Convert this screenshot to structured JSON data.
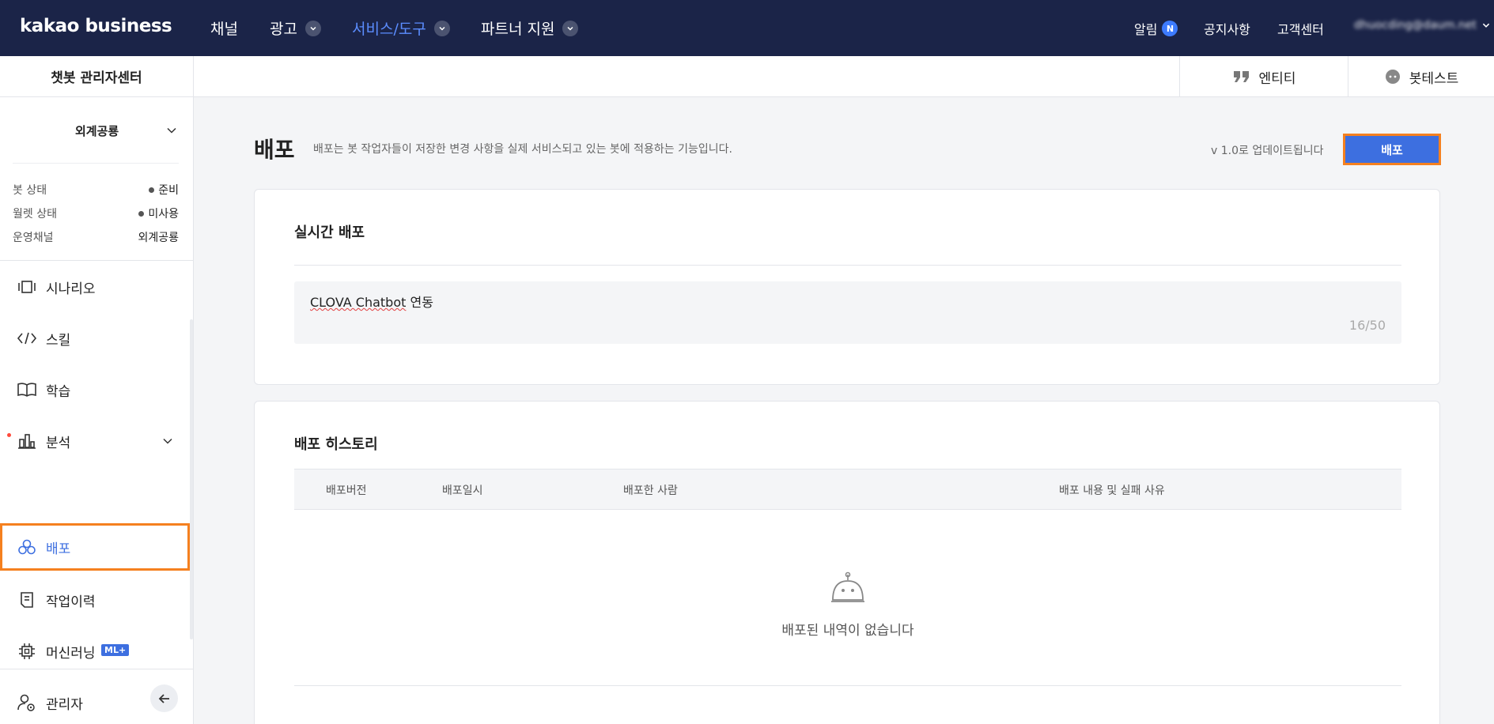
{
  "topbar": {
    "logo": "kakao business",
    "nav": [
      {
        "label": "채널"
      },
      {
        "label": "광고"
      },
      {
        "label": "서비스/도구"
      },
      {
        "label": "파트너 지원"
      }
    ],
    "notifications_label": "알림",
    "notifications_badge": "N",
    "notice_label": "공지사항",
    "support_label": "고객센터",
    "account_label": "dhuocding@daum.net"
  },
  "sidebar": {
    "title": "챗봇 관리자센터",
    "channel_select": "외계공룡",
    "status": [
      {
        "label": "봇 상태",
        "value": "준비"
      },
      {
        "label": "월렛 상태",
        "value": "미사용"
      },
      {
        "label": "운영채널",
        "value": "외계공룡"
      }
    ],
    "menu": [
      {
        "label": "시나리오",
        "icon": "scenario-icon"
      },
      {
        "label": "스킬",
        "icon": "code-icon"
      },
      {
        "label": "학습",
        "icon": "book-icon"
      },
      {
        "label": "분석",
        "icon": "chart-icon"
      },
      {
        "label": "배포",
        "icon": "deploy-icon"
      },
      {
        "label": "작업이력",
        "icon": "history-icon"
      },
      {
        "label": "머신러닝",
        "icon": "chip-icon",
        "badge": "ML+"
      },
      {
        "label": "관리자",
        "icon": "admin-icon"
      }
    ]
  },
  "subheader": {
    "entity_label": "엔티티",
    "bottest_label": "봇테스트"
  },
  "main": {
    "title": "배포",
    "description": "배포는 봇 작업자들이 저장한 변경 사항을 실제 서비스되고 있는 봇에 적용하는 기능입니다.",
    "version_text": "v 1.0로 업데이트됩니다",
    "deploy_button": "배포",
    "realtime": {
      "title": "실시간 배포",
      "input_prefix": "CLOVA Chatbot",
      "input_suffix": " 연동",
      "char_count": "16/50"
    },
    "history": {
      "title": "배포 히스토리",
      "columns": [
        "배포버전",
        "배포일시",
        "배포한 사람",
        "배포 내용 및 실패 사유"
      ],
      "empty_text": "배포된 내역이 없습니다"
    }
  },
  "colors": {
    "topbar_bg": "#1b2448",
    "accent": "#3d6fe0",
    "highlight": "#f5801f"
  }
}
